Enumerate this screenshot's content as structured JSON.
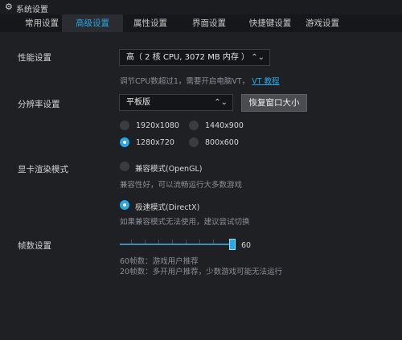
{
  "window": {
    "title": "系统设置"
  },
  "tabs": [
    {
      "label": "常用设置",
      "active": false
    },
    {
      "label": "高级设置",
      "active": true
    },
    {
      "label": "属性设置",
      "active": false
    },
    {
      "label": "界面设置",
      "active": false
    },
    {
      "label": "快捷键设置",
      "active": false
    },
    {
      "label": "游戏设置",
      "active": false
    }
  ],
  "performance": {
    "label": "性能设置",
    "selected": "高（ 2 核 CPU, 3072 MB 内存 ）",
    "hint": "调节CPU数超过1，需要开启电脑VT，",
    "hint_link": "VT 教程"
  },
  "resolution": {
    "label": "分辨率设置",
    "selected": "平板版",
    "restore_button": "恢复窗口大小",
    "options": [
      {
        "label": "1920x1080",
        "checked": false
      },
      {
        "label": "1440x900",
        "checked": false
      },
      {
        "label": "1280x720",
        "checked": true
      },
      {
        "label": "800x600",
        "checked": false
      }
    ]
  },
  "render": {
    "label": "显卡渲染模式",
    "compat_label": "兼容模式(OpenGL)",
    "compat_checked": false,
    "compat_hint": "兼容性好，可以流畅运行大多数游戏",
    "speed_label": "极速模式(DirectX)",
    "speed_checked": true,
    "speed_hint": "如果兼容模式无法使用，建议尝试切换"
  },
  "fps": {
    "label": "帧数设置",
    "value": "60",
    "value_fraction": 0.95,
    "hint1": "60帧数：游戏用户推荐",
    "hint2": "20帧数：多开用户推荐，少数游戏可能无法运行"
  },
  "icons": {
    "title": "gear-icon",
    "select": "chevron-updown-icon"
  },
  "colors": {
    "accent": "#27a7e8",
    "background": "#1e2024"
  }
}
